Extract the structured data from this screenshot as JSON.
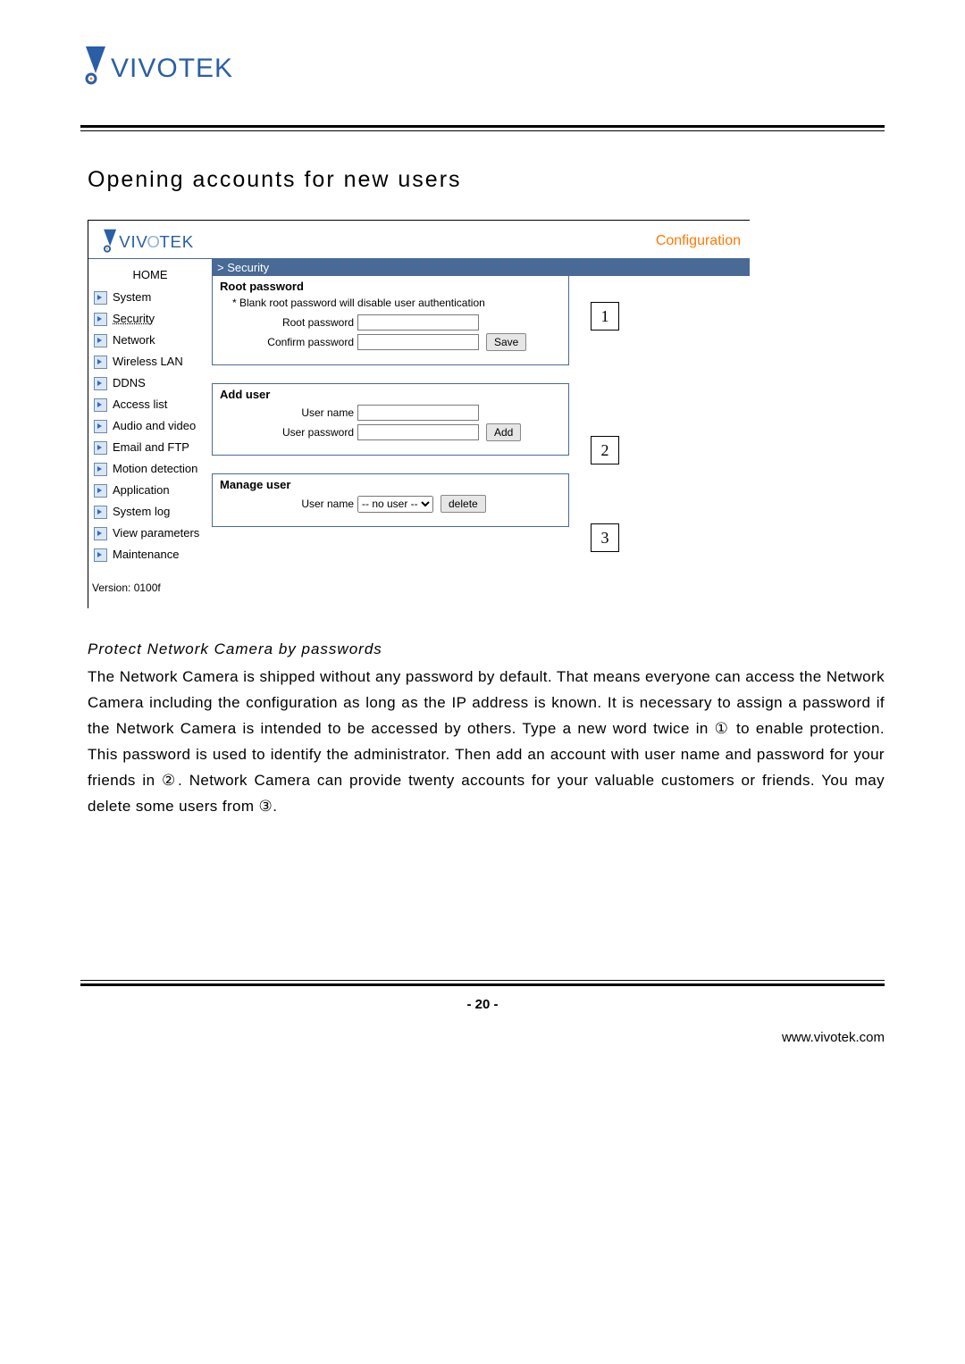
{
  "header": {
    "brand": "VIVOTEK"
  },
  "page_title": "Opening accounts for new users",
  "screenshot": {
    "brand": "VIVOTEK",
    "configuration_label": "Configuration",
    "home_label": "HOME",
    "nav_items": [
      "System",
      "Security",
      "Network",
      "Wireless LAN",
      "DDNS",
      "Access list",
      "Audio and video",
      "Email and FTP",
      "Motion detection",
      "Application",
      "System log",
      "View parameters",
      "Maintenance"
    ],
    "version_label": "Version: 0100f",
    "breadcrumb": "> Security",
    "panel1": {
      "title": "Root password",
      "note": "* Blank root password will disable user authentication",
      "label_root": "Root password",
      "label_confirm": "Confirm password",
      "save_label": "Save"
    },
    "panel2": {
      "title": "Add user",
      "label_user": "User name",
      "label_pass": "User password",
      "add_label": "Add"
    },
    "panel3": {
      "title": "Manage user",
      "label_user": "User name",
      "select_option": "-- no user --",
      "delete_label": "delete"
    },
    "callouts": {
      "c1": "1",
      "c2": "2",
      "c3": "3"
    }
  },
  "subheading": "Protect Network Camera by passwords",
  "body_text": "The Network Camera is shipped without any password by default. That means everyone can access the Network Camera including the configuration as long as the IP address is known. It is necessary to assign a password if the Network Camera is intended to be accessed by others. Type a new word twice in ① to enable protection. This password is used to identify the administrator. Then add an account with user name and password for your friends in ②. Network Camera can provide twenty accounts for your valuable customers or friends. You may delete some users from ③.",
  "page_number": "- 20 -",
  "footer_url": "www.vivotek.com"
}
